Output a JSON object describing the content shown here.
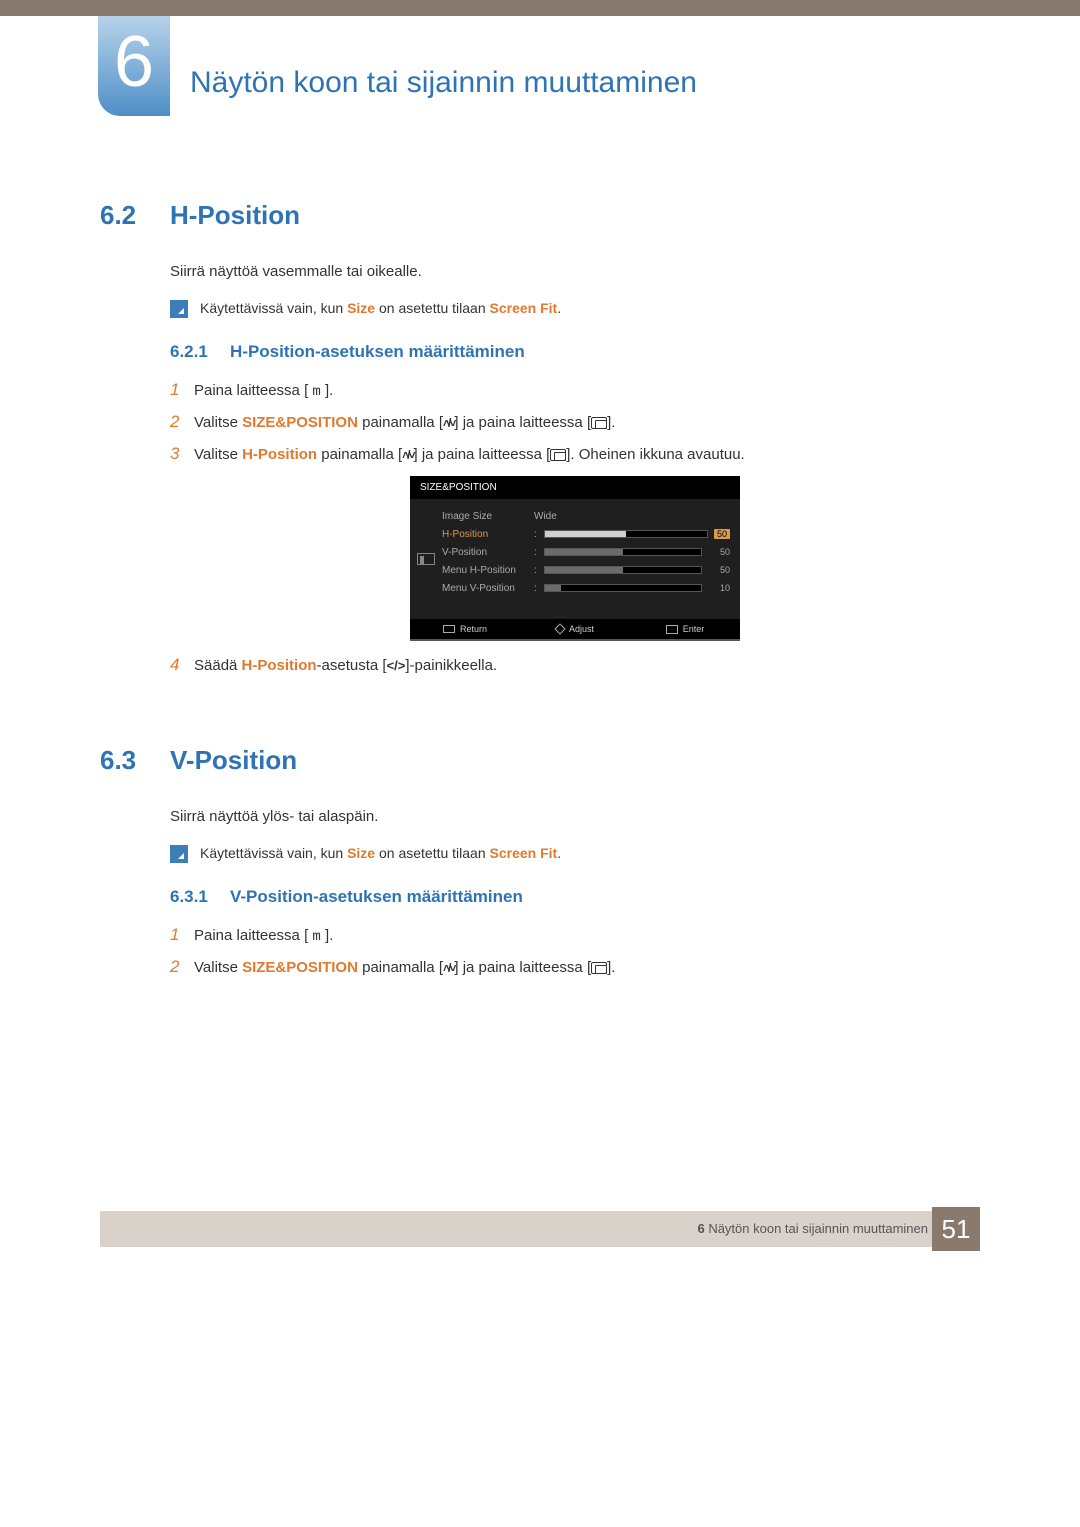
{
  "chapter": {
    "number": "6",
    "title": "Näytön koon tai sijainnin muuttaminen"
  },
  "section62": {
    "num": "6.2",
    "title": "H-Position",
    "intro": "Siirrä näyttöä vasemmalle tai oikealle.",
    "note_pre": "Käytettävissä vain, kun ",
    "note_size": "Size",
    "note_mid": " on asetettu tilaan ",
    "note_fit": "Screen Fit",
    "note_suf": ".",
    "sub_num": "6.2.1",
    "sub_title": "H-Position-asetuksen määrittäminen",
    "step1_pre": "Paina laitteessa [ ",
    "step1_key": "m",
    "step1_suf": " ].",
    "step2_pre": "Valitse ",
    "step2_sp": "SIZE&POSITION",
    "step2_mid1": " painamalla [",
    "step2_mid2": "] ja paina laitteessa [",
    "step2_suf": "].",
    "step3_pre": "Valitse ",
    "step3_hp": "H-Position",
    "step3_mid1": " painamalla [",
    "step3_mid2": "] ja paina laitteessa [",
    "step3_suf": "]. Oheinen ikkuna avautuu.",
    "step4_pre": "Säädä ",
    "step4_hp": "H-Position",
    "step4_mid": "-asetusta [",
    "step4_suf": "]-painikkeella."
  },
  "osd": {
    "title": "SIZE&POSITION",
    "rows": [
      {
        "label": "Image Size",
        "value": "Wide",
        "type": "text"
      },
      {
        "label": "H-Position",
        "value": "50",
        "type": "slider",
        "fill": 50,
        "active": true
      },
      {
        "label": "V-Position",
        "value": "50",
        "type": "slider",
        "fill": 50
      },
      {
        "label": "Menu H-Position",
        "value": "50",
        "type": "slider",
        "fill": 50
      },
      {
        "label": "Menu V-Position",
        "value": "10",
        "type": "slider",
        "fill": 10
      }
    ],
    "footer": {
      "return": "Return",
      "adjust": "Adjust",
      "enter": "Enter"
    }
  },
  "section63": {
    "num": "6.3",
    "title": "V-Position",
    "intro": "Siirrä näyttöä ylös- tai alaspäin.",
    "note_pre": "Käytettävissä vain, kun ",
    "note_size": "Size",
    "note_mid": " on asetettu tilaan ",
    "note_fit": "Screen Fit",
    "note_suf": ".",
    "sub_num": "6.3.1",
    "sub_title": "V-Position-asetuksen määrittäminen",
    "step1_pre": "Paina laitteessa [ ",
    "step1_key": "m",
    "step1_suf": " ].",
    "step2_pre": "Valitse ",
    "step2_sp": "SIZE&POSITION",
    "step2_mid1": " painamalla [",
    "step2_mid2": "] ja paina laitteessa [",
    "step2_suf": "]."
  },
  "footer": {
    "chapter_num": "6",
    "chapter_title": "Näytön koon tai sijainnin muuttaminen",
    "page": "51"
  }
}
